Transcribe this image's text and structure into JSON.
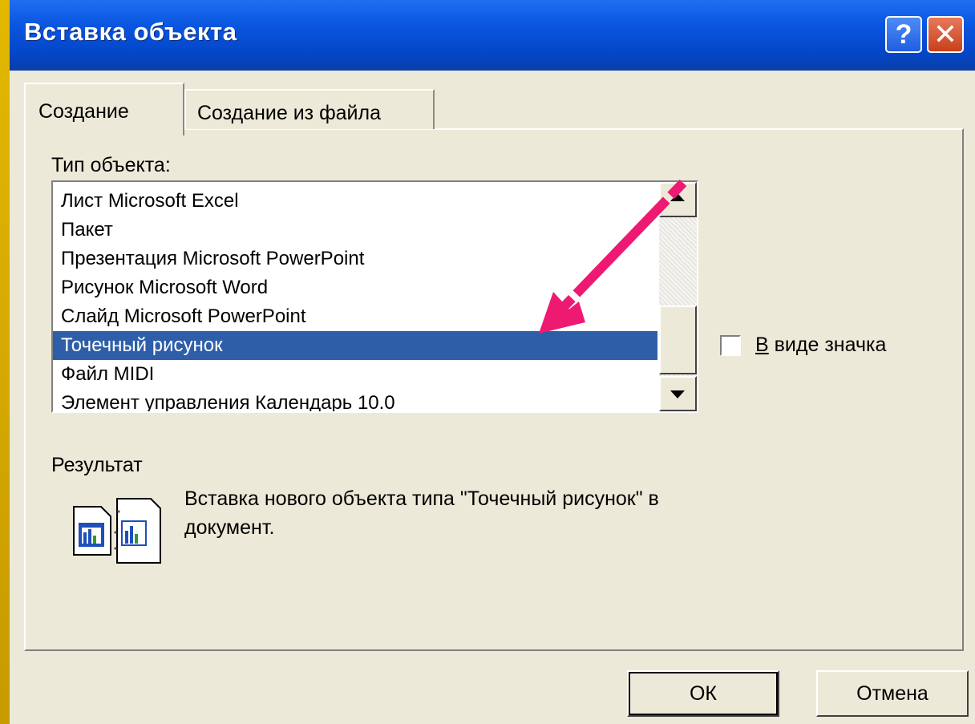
{
  "window": {
    "title": "Вставка объекта",
    "help_icon": "question-mark",
    "close_icon": "x"
  },
  "tabs": [
    {
      "label": "Создание",
      "active": true
    },
    {
      "label": "Создание из файла",
      "active": false
    }
  ],
  "object_type": {
    "label": "Тип объекта:",
    "items": [
      "Лист Microsoft Excel",
      "Пакет",
      "Презентация Microsoft PowerPoint",
      "Рисунок Microsoft Word",
      "Слайд Microsoft PowerPoint",
      "Точечный рисунок",
      "Файл MIDI",
      "Элемент управления Календарь 10.0"
    ],
    "selected": "Точечный рисунок"
  },
  "display_as_icon": {
    "label": "В виде значка",
    "checked": false
  },
  "result": {
    "label": "Результат",
    "text": "Вставка нового объекта типа \"Точечный рисунок\" в документ."
  },
  "buttons": {
    "ok": "ОК",
    "cancel": "Отмена"
  },
  "colors": {
    "titlebar": "#0a56e0",
    "selection": "#2f5ea8",
    "annotation_arrow": "#ee1a72",
    "slide_background": "#c9a000"
  }
}
